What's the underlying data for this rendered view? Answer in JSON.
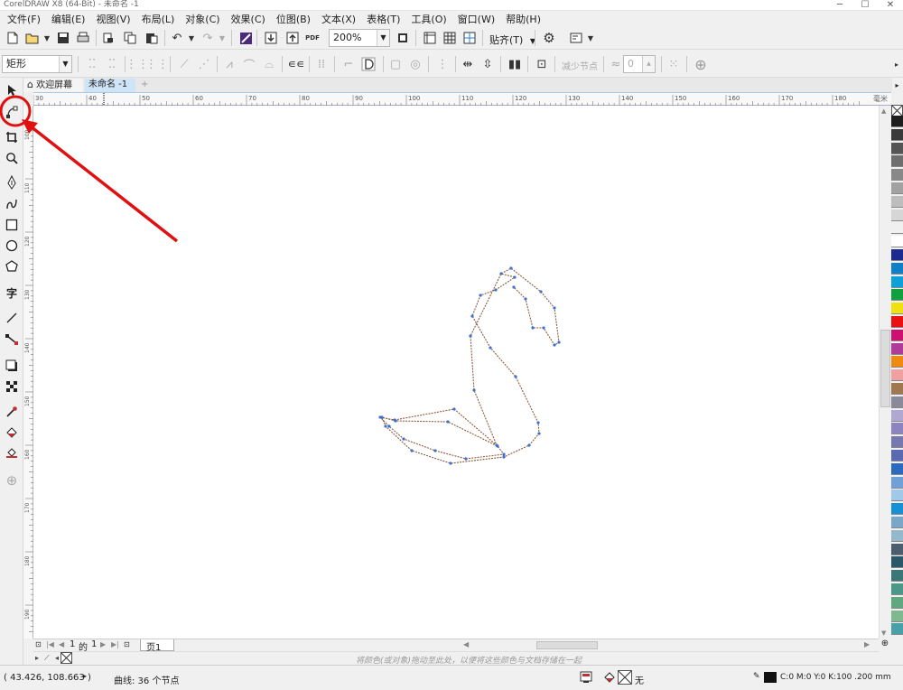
{
  "app": {
    "title": "CorelDRAW X8 (64-Bit) - 未命名 -1",
    "controls": [
      "─",
      "☐",
      "✕"
    ]
  },
  "menu": [
    "文件(F)",
    "编辑(E)",
    "视图(V)",
    "布局(L)",
    "对象(C)",
    "效果(C)",
    "位图(B)",
    "文本(X)",
    "表格(T)",
    "工具(O)",
    "窗口(W)",
    "帮助(H)"
  ],
  "toolbar": {
    "zoom": "200%",
    "snap": "贴齐(T)",
    "pdf": "PDF"
  },
  "property_bar": {
    "shape_select": "矩形",
    "reduce_nodes": "减少节点",
    "smoothness": "0"
  },
  "tabs": {
    "welcome": "欢迎屏幕",
    "doc": "未命名 -1",
    "add": "+"
  },
  "ruler": {
    "h_ticks": [
      "30",
      "40",
      "50",
      "60",
      "70",
      "80",
      "90",
      "100",
      "110",
      "120",
      "130",
      "140",
      "150",
      "160",
      "170",
      "180"
    ],
    "v_ticks": [
      "100",
      "110",
      "120",
      "130",
      "140",
      "150",
      "160",
      "170",
      "180",
      "190"
    ],
    "unit": "毫米"
  },
  "pagenav": {
    "current": "1",
    "of": "的",
    "total": "1",
    "page_tab": "页1"
  },
  "doc_palette_hint": "将颜色(或对象)拖动至此处，以便将这些颜色与文档存储在一起",
  "status": {
    "coords": "( 43.426, 108.663 )",
    "object": "曲线: 36 个节点",
    "fill_none": "无",
    "color_info": "C:0 M:0 Y:0 K:100  .200 mm"
  },
  "colors": {
    "annotation": "#e01010",
    "curve": "#8b5a3c",
    "node": "#3d6fd1",
    "selection": "#2d7bd6"
  },
  "palette": [
    "#1e1e1e",
    "#3a3a3a",
    "#555555",
    "#6e6e6e",
    "#888888",
    "#a2a2a2",
    "#bdbdbd",
    "#d6d6d6",
    "#f0f0f0",
    "#ffffff",
    "#1d2b8f",
    "#1080c8",
    "#0ea0d8",
    "#10a040",
    "#f0e010",
    "#e81010",
    "#d01070",
    "#b03a9a",
    "#f08a10",
    "#f0a0a0",
    "#a07850",
    "#8a8a9a",
    "#b0a8d0",
    "#8c84c0",
    "#7878b0",
    "#5a6ab0",
    "#2a6ac0",
    "#70a0d8",
    "#a0c8e8",
    "#1890d8",
    "#7aa6c8",
    "#94b8cc",
    "#4a5e70",
    "#2a5868",
    "#3a7878",
    "#4a9888",
    "#60a880",
    "#80b890",
    "#48a0a8"
  ]
}
